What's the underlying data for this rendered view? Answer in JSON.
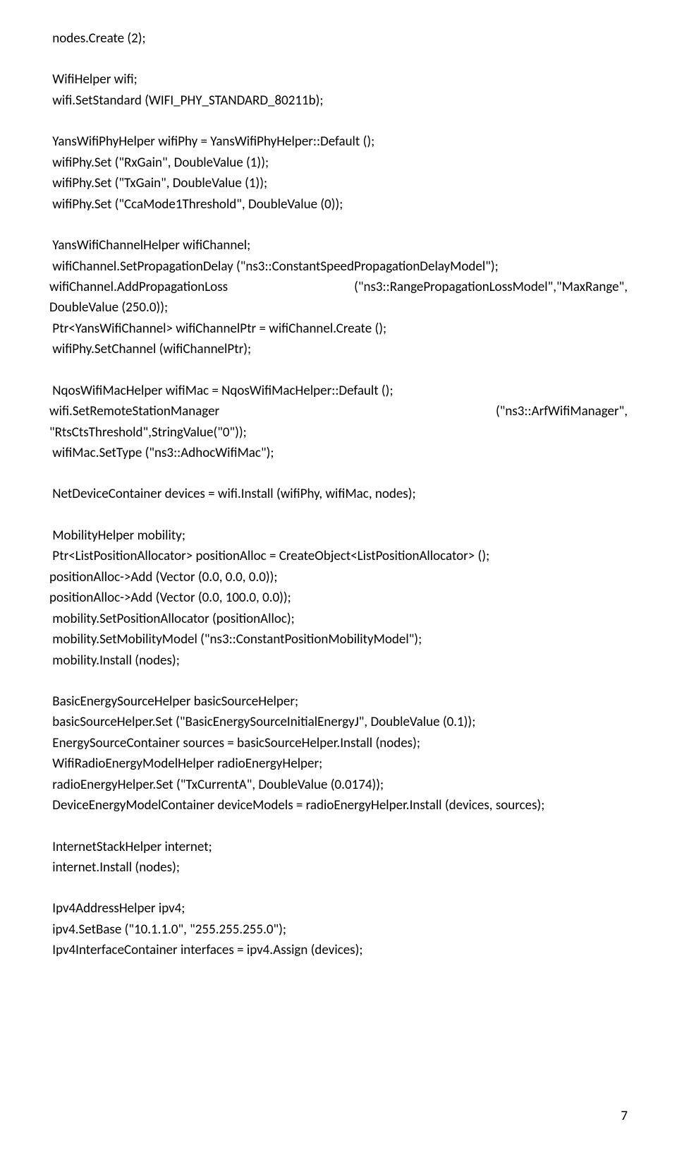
{
  "page_number": "7",
  "code": {
    "l1": " nodes.Create (2);",
    "l3": " WifiHelper wifi;",
    "l4": " wifi.SetStandard (WIFI_PHY_STANDARD_80211b);",
    "l6": " YansWifiPhyHelper wifiPhy = YansWifiPhyHelper::Default ();",
    "l7": " wifiPhy.Set (\"RxGain\", DoubleValue (1));",
    "l8": " wifiPhy.Set (\"TxGain\", DoubleValue (1));",
    "l9": " wifiPhy.Set (\"CcaMode1Threshold\", DoubleValue (0));",
    "l11": " YansWifiChannelHelper wifiChannel;",
    "l12": " wifiChannel.SetPropagationDelay (\"ns3::ConstantSpeedPropagationDelayModel\");",
    "l13a": " wifiChannel.AddPropagationLoss",
    "l13b": "(\"ns3::RangePropagationLossModel\",\"MaxRange\",",
    "l14": "DoubleValue (250.0));",
    "l15": " Ptr<YansWifiChannel> wifiChannelPtr = wifiChannel.Create ();",
    "l16": " wifiPhy.SetChannel (wifiChannelPtr);",
    "l18": " NqosWifiMacHelper wifiMac = NqosWifiMacHelper::Default ();",
    "l19a": " wifi.SetRemoteStationManager",
    "l19b": "(\"ns3::ArfWifiManager\",",
    "l20": "\"RtsCtsThreshold\",StringValue(\"0\"));",
    "l21": " wifiMac.SetType (\"ns3::AdhocWifiMac\");",
    "l23": " NetDeviceContainer devices = wifi.Install (wifiPhy, wifiMac, nodes);",
    "l25": " MobilityHelper mobility;",
    "l26": " Ptr<ListPositionAllocator> positionAlloc = CreateObject<ListPositionAllocator> ();",
    "l27": "positionAlloc->Add (Vector (0.0, 0.0, 0.0));",
    "l28": "positionAlloc->Add (Vector (0.0, 100.0, 0.0));",
    "l29": " mobility.SetPositionAllocator (positionAlloc);",
    "l30": " mobility.SetMobilityModel (\"ns3::ConstantPositionMobilityModel\");",
    "l31": " mobility.Install (nodes);",
    "l33": " BasicEnergySourceHelper basicSourceHelper;",
    "l34": " basicSourceHelper.Set (\"BasicEnergySourceInitialEnergyJ\", DoubleValue (0.1));",
    "l35": " EnergySourceContainer sources = basicSourceHelper.Install (nodes);",
    "l36": " WifiRadioEnergyModelHelper radioEnergyHelper;",
    "l37": " radioEnergyHelper.Set (\"TxCurrentA\", DoubleValue (0.0174));",
    "l38": " DeviceEnergyModelContainer deviceModels = radioEnergyHelper.Install (devices, sources);",
    "l40": " InternetStackHelper internet;",
    "l41": " internet.Install (nodes);",
    "l43": " Ipv4AddressHelper ipv4;",
    "l44": " ipv4.SetBase (\"10.1.1.0\", \"255.255.255.0\");",
    "l45": " Ipv4InterfaceContainer interfaces = ipv4.Assign (devices);"
  }
}
